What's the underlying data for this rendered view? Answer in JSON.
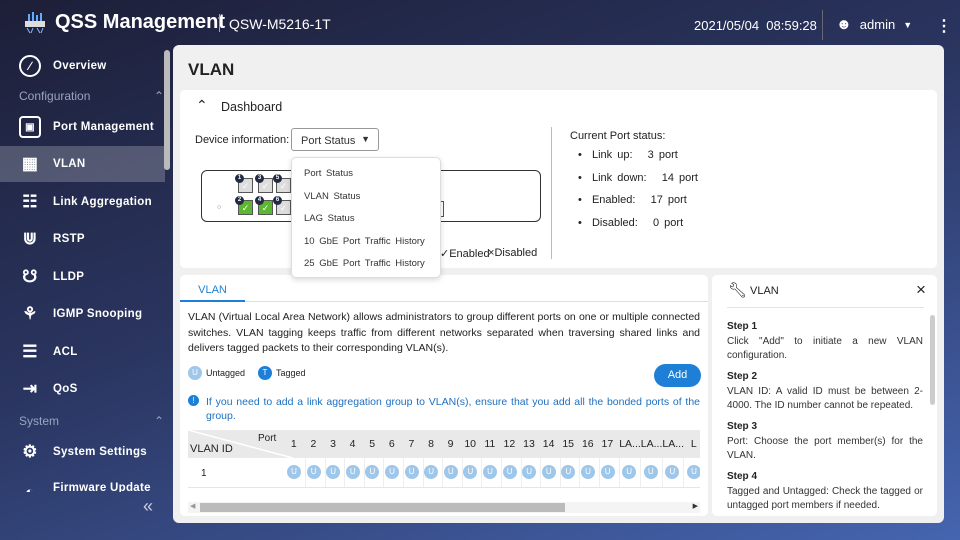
{
  "header": {
    "app_title": "QSS Management",
    "model": "QSW-M5216-1T",
    "datetime": "2021/05/04  08:59:28",
    "user": "admin"
  },
  "sidebar": {
    "items": [
      {
        "label": "Overview",
        "icon": "gauge-icon"
      },
      {
        "label": "Port Management",
        "icon": "port-icon"
      },
      {
        "label": "VLAN",
        "icon": "vlan-icon"
      },
      {
        "label": "Link Aggregation",
        "icon": "link-aggregation-icon"
      },
      {
        "label": "RSTP",
        "icon": "rstp-icon"
      },
      {
        "label": "LLDP",
        "icon": "lldp-icon"
      },
      {
        "label": "IGMP Snooping",
        "icon": "igmp-icon"
      },
      {
        "label": "ACL",
        "icon": "acl-icon"
      },
      {
        "label": "QoS",
        "icon": "qos-icon"
      },
      {
        "label": "System Settings",
        "icon": "gear-icon"
      },
      {
        "label": "Firmware Update",
        "icon": "firmware-icon"
      }
    ],
    "sections": {
      "configuration": "Configuration",
      "system": "System"
    }
  },
  "page": {
    "title": "VLAN"
  },
  "dashboard": {
    "title": "Dashboard",
    "device_info_label": "Device information:",
    "selected": "Port Status",
    "options": [
      "Port Status",
      "VLAN Status",
      "LAG Status",
      "10 GbE Port Traffic History",
      "25 GbE Port Traffic History"
    ],
    "legend_enabled": "Enabled",
    "legend_disabled": "Disabled",
    "port_status_title": "Current Port status:",
    "status": [
      {
        "label": "Link up:",
        "value": "3 port"
      },
      {
        "label": "Link down:",
        "value": "14 port"
      },
      {
        "label": "Enabled:",
        "value": "17 port"
      },
      {
        "label": "Disabled:",
        "value": "0 port"
      }
    ],
    "ports": [
      {
        "n": "1",
        "on": false
      },
      {
        "n": "3",
        "on": false
      },
      {
        "n": "5",
        "on": false
      },
      {
        "n": "2",
        "on": true
      },
      {
        "n": "4",
        "on": true
      },
      {
        "n": "6",
        "on": false
      }
    ]
  },
  "vlan": {
    "tab": "VLAN",
    "description": "VLAN (Virtual Local Area Network) allows administrators to group different ports on one or multiple connected switches. VLAN tagging keeps traffic from different networks separated when traversing shared links and delivers tagged packets to their corresponding VLAN(s).",
    "untagged": "Untagged",
    "tagged": "Tagged",
    "add": "Add",
    "note": "If you need to add a link aggregation group to VLAN(s), ensure that you add all the bonded ports of the group.",
    "table": {
      "col_port": "Port",
      "col_vlan_id": "VLAN ID",
      "ports": [
        "1",
        "2",
        "3",
        "4",
        "5",
        "6",
        "7",
        "8",
        "9",
        "10",
        "11",
        "12",
        "13",
        "14",
        "15",
        "16",
        "17",
        "LA...",
        "LA...",
        "LA...",
        "L"
      ],
      "rows": [
        {
          "id": "1",
          "members": [
            "U",
            "U",
            "U",
            "U",
            "U",
            "U",
            "U",
            "U",
            "U",
            "U",
            "U",
            "U",
            "U",
            "U",
            "U",
            "U",
            "U",
            "U",
            "U",
            "U",
            "U"
          ]
        }
      ]
    }
  },
  "help": {
    "title": "VLAN",
    "steps": [
      {
        "title": "Step 1",
        "text": "Click \"Add\" to initiate a new VLAN configuration."
      },
      {
        "title": "Step 2",
        "text": "VLAN ID: A valid ID must be between 2-4000. The ID number cannot be repeated."
      },
      {
        "title": "Step 3",
        "text": "Port: Choose the port member(s) for the VLAN."
      },
      {
        "title": "Step 4",
        "text": "Tagged and Untagged: Check the tagged or untagged port members if needed."
      }
    ]
  }
}
